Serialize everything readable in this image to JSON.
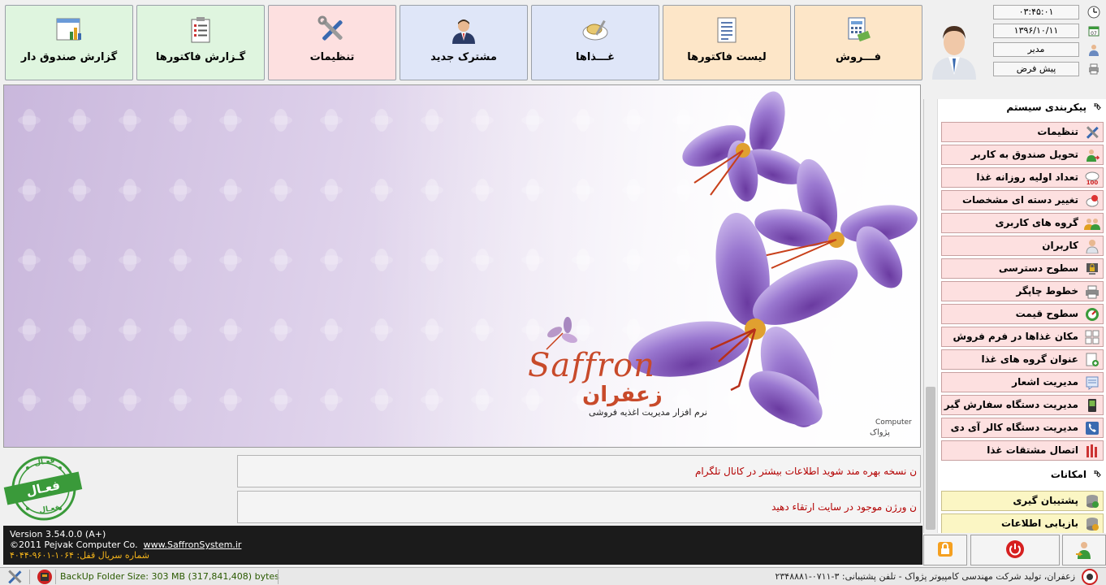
{
  "toolbar": {
    "sales": "فـــروش",
    "invoices_list": "لیست فاکتورها",
    "foods": "غـــذاها",
    "new_customer": "مشترک جدید",
    "settings": "تنظیمات",
    "invoice_report": "گـزارش فاکتورها",
    "cashier_report": "گزارش صندوق دار"
  },
  "colors": {
    "sales_bg": "#fde6c8",
    "invoices_bg": "#fde6c8",
    "foods_bg": "#dfe6f8",
    "customer_bg": "#dfe6f8",
    "settings_bg": "#fde0e0",
    "report_bg": "#dff5df"
  },
  "user_panel": {
    "time": "۰۳:۴۵:۰۱",
    "date": "۱۳۹۶/۱۰/۱۱",
    "role": "مدیر",
    "profile": "پیش فرض"
  },
  "menu": {
    "system_section": "پیکربندی سیستم",
    "system_items": [
      "تنظیمات",
      "تحویل صندوق به کاربر",
      "تعداد اولیه روزانه غذا",
      "تغییر دسته ای مشخصات غذاها",
      "گروه های کاربری",
      "کاربران",
      "سطوح دسترسی",
      "خطوط چاپگر",
      "سطوح قیمت",
      "مکان غذاها در فرم فروش",
      "عنوان گروه های غذا",
      "مدیریت اشعار",
      "مدیریت دستگاه سفارش گیر",
      "مدیریت دستگاه کالر آی دی",
      "اتصال مشتقات غذا"
    ],
    "features_section": "امکانات",
    "feature_items": [
      "پشتیبان گیری",
      "بازیابی اطلاعات"
    ]
  },
  "banner": {
    "logo_en": "Saffron",
    "logo_fa": "زعفران",
    "tagline": "نرم افزار مدیریت اغذیه فروشی",
    "corner_en": "Computer",
    "corner_fa": "پژواک"
  },
  "messages": {
    "line1": "ن نسخه بهره مند شوید اطلاعات بیشتر در کانال تلگرام",
    "line2": "ن ورژن موجود در سایت ارتقاء دهید"
  },
  "stamp": {
    "main": "فعـال",
    "top": "فعـال",
    "bottom": "فعـال"
  },
  "version": {
    "version": "Version 3.54.0.0 (A+)",
    "copyright": "©2011 Pejvak Computer Co.",
    "site": "www.SaffronSystem.ir",
    "serial": "شماره سریال قفل: ۱۰۶۴-۹۶۰۱-۴۰۴۴"
  },
  "status": {
    "backup": "BackUp Folder Size: 303 MB (317,841,408) bytes",
    "company": "زعفران، تولید شرکت مهندسی کامپیوتر پژواک - تلفن پشتیبانی: ۳-۰۷۱۱-۲۳۴۸۸۸۱"
  }
}
